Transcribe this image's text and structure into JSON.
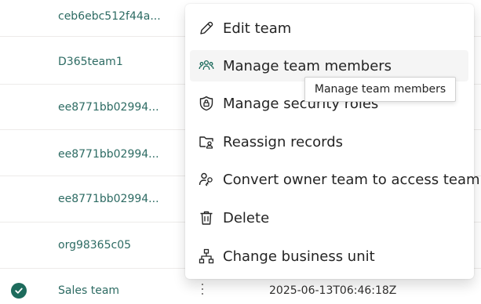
{
  "rows": [
    {
      "name": "ceb6ebc512f44a...",
      "date": ""
    },
    {
      "name": "D365team1",
      "date": ""
    },
    {
      "name": "ee8771bb02994...",
      "date": ""
    },
    {
      "name": "ee8771bb02994...",
      "date": ""
    },
    {
      "name": "ee8771bb02994...",
      "date": ""
    },
    {
      "name": "org98365c05",
      "date": ""
    },
    {
      "name": "Sales team",
      "date": "2025-06-13T06:46:18Z"
    }
  ],
  "menu": {
    "items": [
      {
        "label": "Edit team",
        "icon": "pencil-icon"
      },
      {
        "label": "Manage team members",
        "icon": "people-team-icon"
      },
      {
        "label": "Manage security roles",
        "icon": "shield-lock-icon"
      },
      {
        "label": "Reassign records",
        "icon": "folder-person-icon"
      },
      {
        "label": "Convert owner team to access team",
        "icon": "person-key-icon"
      },
      {
        "label": "Delete",
        "icon": "trash-icon"
      },
      {
        "label": "Change business unit",
        "icon": "org-chart-icon"
      }
    ]
  },
  "tooltip": {
    "text": "Manage team members"
  },
  "colors": {
    "link": "#2d6b63",
    "check": "#1d6b5c",
    "hover": "#f5f5f5"
  }
}
